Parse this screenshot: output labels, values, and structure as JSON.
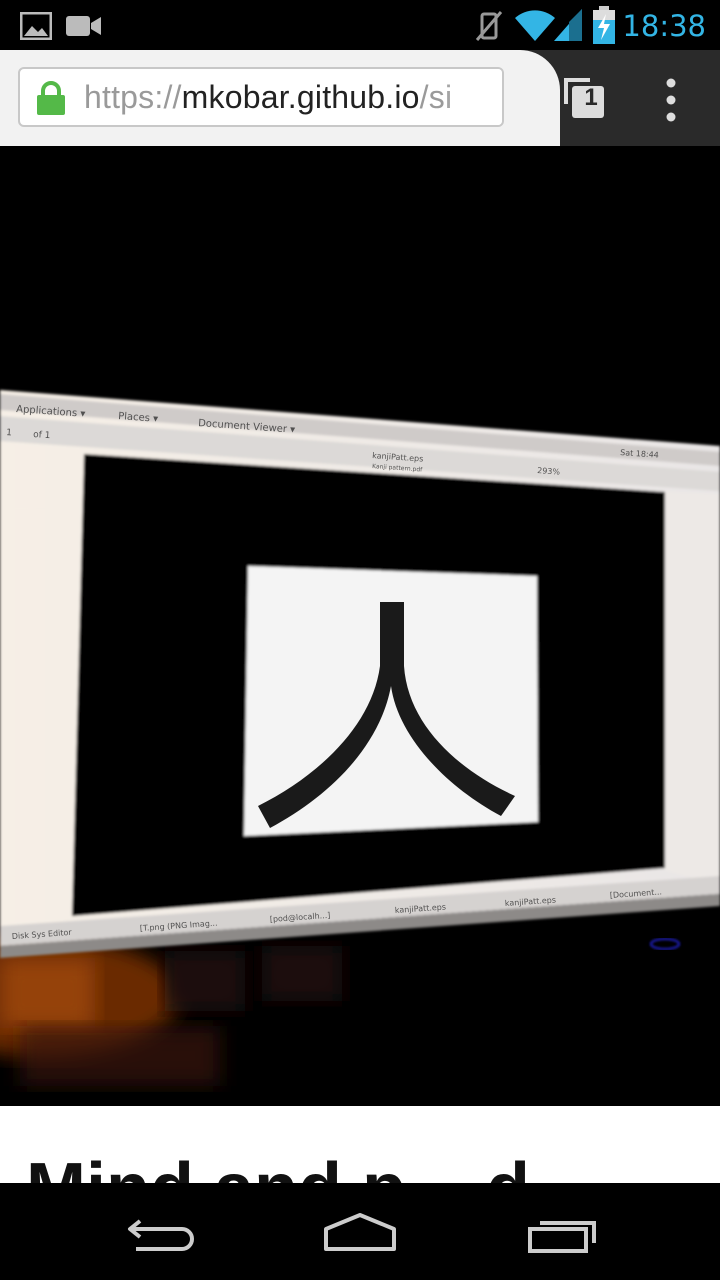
{
  "status_bar": {
    "time": "18:38",
    "time_color": "#33b5e5",
    "icons": [
      "gallery-notification-icon",
      "video-notification-icon",
      "vibrate-off-icon",
      "wifi-icon",
      "cell-signal-icon",
      "battery-charging-icon"
    ]
  },
  "browser": {
    "url_scheme": "https://",
    "url_host": "mkobar.github.io",
    "url_path": "/si",
    "tab_count": "1",
    "menu_icon": "overflow-menu-icon",
    "secure_icon": "lock-icon"
  },
  "photo": {
    "subject": "monitor showing document viewer with kanji character",
    "panel_menus": [
      "Applications ▾",
      "Places ▾",
      "Document Viewer ▾"
    ],
    "page_field": "1",
    "page_of": "of 1",
    "doc_title": "kanjiPatt.eps",
    "doc_subtitle": "Kanji pattern.pdf",
    "clock": "Sat 18:44",
    "zoom": "293%",
    "kanji": "人",
    "taskbar_items": [
      "Disk Sys Editor",
      "[T.png (PNG Imag...",
      "[pod@localh...]",
      "kanjiPatt.eps",
      "kanjiPatt.eps",
      "[Document..."
    ]
  },
  "article": {
    "heading": "Mind and p... d"
  },
  "nav": {
    "back_icon": "back-icon",
    "home_icon": "home-icon",
    "recents_icon": "recents-icon"
  }
}
